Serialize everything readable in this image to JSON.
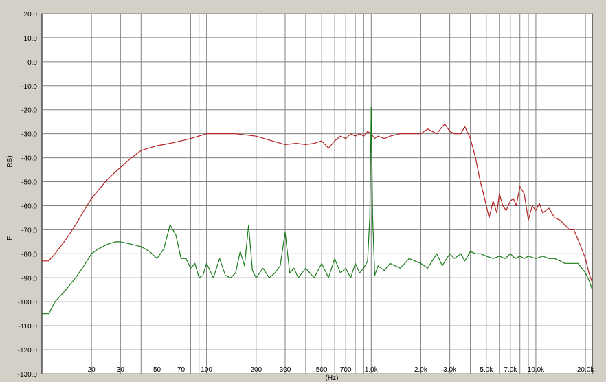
{
  "chart_data": {
    "type": "line",
    "title": "",
    "xlabel": "(Hz)",
    "ylabel": "RB)",
    "ylabel_prefix": "F",
    "x_scale": "log",
    "xlim": [
      10,
      22000
    ],
    "ylim": [
      -130,
      20
    ],
    "grid": true,
    "colors": {
      "background": "#ffffff",
      "frame": "#d4d0c8",
      "grid": "#808080",
      "series_1": "#b22020",
      "series_2": "#1a7a1a"
    },
    "y_ticks": [
      "20.0",
      "10.0",
      "0.0",
      "-10.0",
      "-20.0",
      "-30.0",
      "-40.0",
      "-50.0",
      "-60.0",
      "-70.0",
      "-80.0",
      "-90.0",
      "-100.0",
      "-110.0",
      "-120.0",
      "-130.0"
    ],
    "x_ticks": [
      "20",
      "30",
      "50",
      "70",
      "100",
      "200",
      "300",
      "500",
      "700",
      "1.0k",
      "2.0k",
      "3.0k",
      "5.0k",
      "7.0k",
      "10.0k",
      "20.0k"
    ],
    "series": [
      {
        "name": "",
        "color": "#b22020",
        "x": [
          10,
          11,
          12,
          14,
          16,
          18,
          20,
          25,
          30,
          35,
          40,
          50,
          60,
          70,
          80,
          100,
          120,
          150,
          200,
          250,
          300,
          350,
          400,
          450,
          500,
          550,
          600,
          650,
          700,
          750,
          800,
          850,
          900,
          950,
          1000,
          1050,
          1100,
          1200,
          1300,
          1500,
          1700,
          2000,
          2200,
          2500,
          2700,
          2800,
          3000,
          3200,
          3500,
          3700,
          4000,
          4300,
          4600,
          4800,
          5000,
          5200,
          5500,
          5800,
          6000,
          6300,
          6600,
          7000,
          7300,
          7600,
          8000,
          8500,
          9000,
          9500,
          10000,
          10500,
          11000,
          12000,
          13000,
          14000,
          15000,
          16000,
          17000,
          18000,
          19000,
          20000,
          21000,
          22000
        ],
        "y": [
          -83,
          -83,
          -80,
          -74,
          -68,
          -62,
          -57,
          -49,
          -44,
          -40,
          -37,
          -35,
          -34,
          -33,
          -32,
          -30,
          -30,
          -30,
          -31,
          -33,
          -34.5,
          -34,
          -34.5,
          -34,
          -33,
          -36,
          -33,
          -31,
          -32,
          -30,
          -31,
          -30,
          -31,
          -29,
          -30,
          -32,
          -31,
          -32,
          -31,
          -30,
          -30,
          -30,
          -28,
          -30,
          -27,
          -26,
          -29,
          -30,
          -30,
          -27,
          -32,
          -40,
          -50,
          -55,
          -60,
          -65,
          -58,
          -63,
          -55,
          -60,
          -62,
          -58,
          -57,
          -60,
          -52,
          -55,
          -66,
          -60,
          -62,
          -59,
          -63,
          -61,
          -65,
          -66,
          -68,
          -70,
          -70,
          -74,
          -78,
          -82,
          -88,
          -92
        ]
      },
      {
        "name": "",
        "color": "#1a7a1a",
        "x": [
          10,
          11,
          12,
          14,
          16,
          18,
          20,
          22,
          25,
          28,
          30,
          35,
          40,
          45,
          50,
          55,
          60,
          65,
          70,
          75,
          80,
          85,
          90,
          95,
          100,
          110,
          120,
          130,
          140,
          150,
          160,
          170,
          180,
          190,
          200,
          220,
          240,
          260,
          280,
          300,
          320,
          340,
          360,
          380,
          400,
          450,
          500,
          550,
          600,
          650,
          700,
          750,
          800,
          850,
          900,
          950,
          980,
          1000,
          1020,
          1050,
          1100,
          1200,
          1300,
          1500,
          1700,
          2000,
          2200,
          2500,
          2700,
          3000,
          3200,
          3500,
          3700,
          4000,
          4300,
          4600,
          5000,
          5500,
          6000,
          6500,
          7000,
          7500,
          8000,
          8500,
          9000,
          10000,
          11000,
          12000,
          13000,
          14000,
          15000,
          16000,
          17000,
          18000,
          19000,
          20000,
          21000,
          22000
        ],
        "y": [
          -105,
          -105,
          -100,
          -95,
          -90,
          -85,
          -80,
          -78,
          -76,
          -75,
          -75,
          -76,
          -77,
          -79,
          -82,
          -78,
          -68,
          -72,
          -82,
          -82,
          -86,
          -84,
          -90,
          -89,
          -84,
          -90,
          -82,
          -89,
          -90,
          -88,
          -79,
          -85,
          -68,
          -87,
          -90,
          -86,
          -90,
          -88,
          -85,
          -71,
          -88,
          -86,
          -90,
          -88,
          -86,
          -90,
          -84,
          -90,
          -82,
          -88,
          -86,
          -90,
          -84,
          -88,
          -86,
          -83,
          -65,
          -19,
          -65,
          -89,
          -85,
          -87,
          -84,
          -86,
          -82,
          -84,
          -86,
          -80,
          -85,
          -80,
          -82,
          -80,
          -83,
          -79,
          -80,
          -80,
          -81,
          -82,
          -81,
          -82,
          -80,
          -82,
          -81,
          -82,
          -81,
          -82,
          -81,
          -82,
          -82,
          -83,
          -84,
          -84,
          -84,
          -84,
          -86,
          -88,
          -91,
          -95
        ]
      }
    ]
  }
}
